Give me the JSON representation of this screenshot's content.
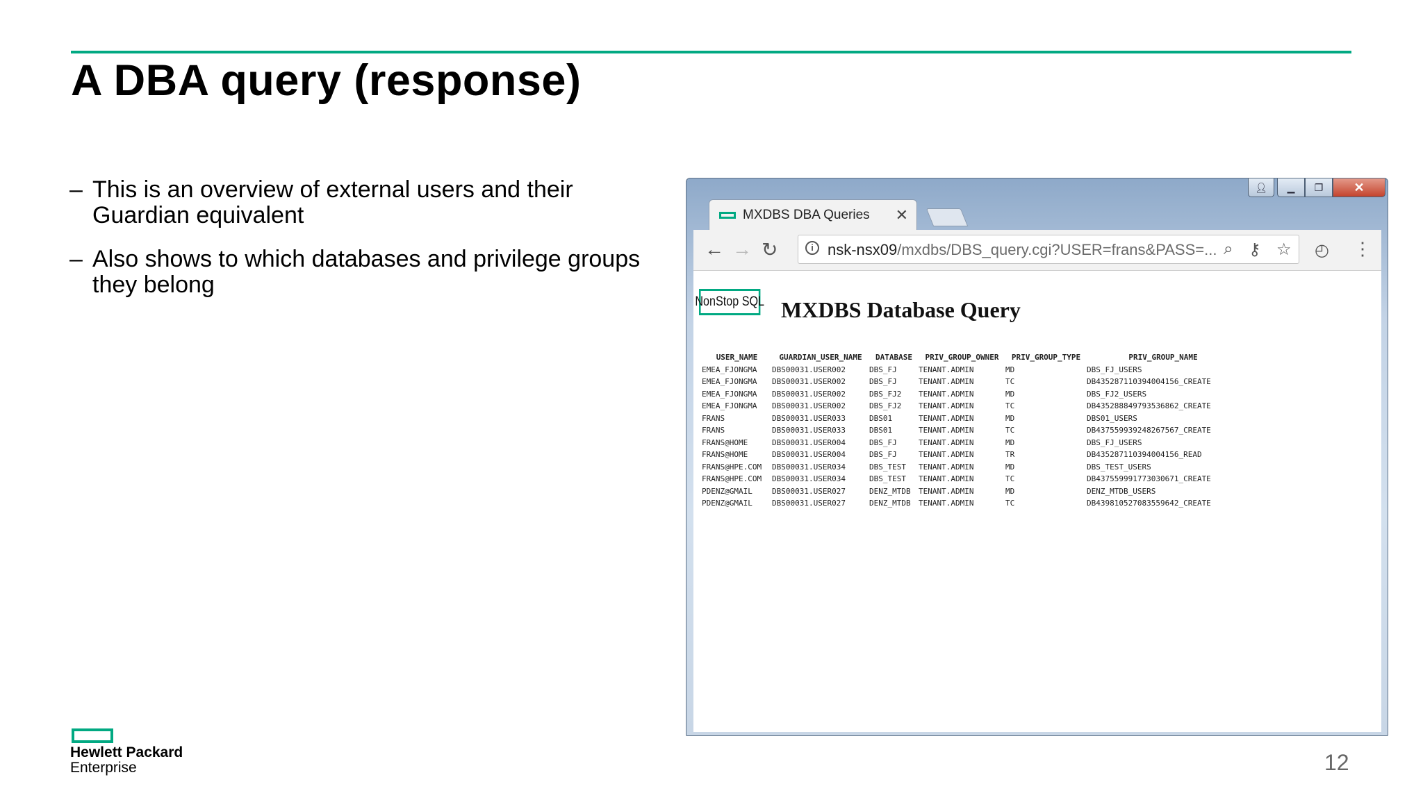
{
  "slide": {
    "title": "A DBA query (response)",
    "bullets": [
      {
        "dash": "–",
        "text": "This is an overview of external users and their Guardian equivalent"
      },
      {
        "dash": "–",
        "text": "Also shows to which databases and privilege groups they belong"
      }
    ],
    "logo_line1": "Hewlett Packard",
    "logo_line2": "Enterprise",
    "page_number": "12",
    "accent_color": "#01a982"
  },
  "browser": {
    "tab_title": "MXDBS DBA Queries",
    "url_host": "nsk-nsx09",
    "url_path": "/mxdbs/DBS_query.cgi?USER=frans&PASS=...",
    "icons": [
      "back-arrow-icon",
      "forward-arrow-icon",
      "reload-icon",
      "info-icon",
      "zoom-icon",
      "key-icon",
      "star-icon",
      "speed-icon",
      "menu-dots-icon"
    ],
    "page": {
      "logo_text": "NonStop SQL",
      "heading": "MXDBS Database Query",
      "table": {
        "columns": [
          "USER_NAME",
          "GUARDIAN_USER_NAME",
          "DATABASE",
          "PRIV_GROUP_OWNER",
          "PRIV_GROUP_TYPE",
          "PRIV_GROUP_NAME"
        ],
        "rows": [
          [
            "EMEA_FJONGMA",
            "DBS00031.USER002",
            "DBS_FJ",
            "TENANT.ADMIN",
            "MD",
            "DBS_FJ_USERS"
          ],
          [
            "EMEA_FJONGMA",
            "DBS00031.USER002",
            "DBS_FJ",
            "TENANT.ADMIN",
            "TC",
            "DB435287110394004156_CREATE"
          ],
          [
            "EMEA_FJONGMA",
            "DBS00031.USER002",
            "DBS_FJ2",
            "TENANT.ADMIN",
            "MD",
            "DBS_FJ2_USERS"
          ],
          [
            "EMEA_FJONGMA",
            "DBS00031.USER002",
            "DBS_FJ2",
            "TENANT.ADMIN",
            "TC",
            "DB435288849793536862_CREATE"
          ],
          [
            "FRANS",
            "DBS00031.USER033",
            "DBS01",
            "TENANT.ADMIN",
            "MD",
            "DBS01_USERS"
          ],
          [
            "FRANS",
            "DBS00031.USER033",
            "DBS01",
            "TENANT.ADMIN",
            "TC",
            "DB437559939248267567_CREATE"
          ],
          [
            "FRANS@HOME",
            "DBS00031.USER004",
            "DBS_FJ",
            "TENANT.ADMIN",
            "MD",
            "DBS_FJ_USERS"
          ],
          [
            "FRANS@HOME",
            "DBS00031.USER004",
            "DBS_FJ",
            "TENANT.ADMIN",
            "TR",
            "DB435287110394004156_READ"
          ],
          [
            "FRANS@HPE.COM",
            "DBS00031.USER034",
            "DBS_TEST",
            "TENANT.ADMIN",
            "MD",
            "DBS_TEST_USERS"
          ],
          [
            "FRANS@HPE.COM",
            "DBS00031.USER034",
            "DBS_TEST",
            "TENANT.ADMIN",
            "TC",
            "DB437559991773030671_CREATE"
          ],
          [
            "PDENZ@GMAIL",
            "DBS00031.USER027",
            "DENZ_MTDB",
            "TENANT.ADMIN",
            "MD",
            "DENZ_MTDB_USERS"
          ],
          [
            "PDENZ@GMAIL",
            "DBS00031.USER027",
            "DENZ_MTDB",
            "TENANT.ADMIN",
            "TC",
            "DB439810527083559642_CREATE"
          ]
        ]
      }
    }
  }
}
